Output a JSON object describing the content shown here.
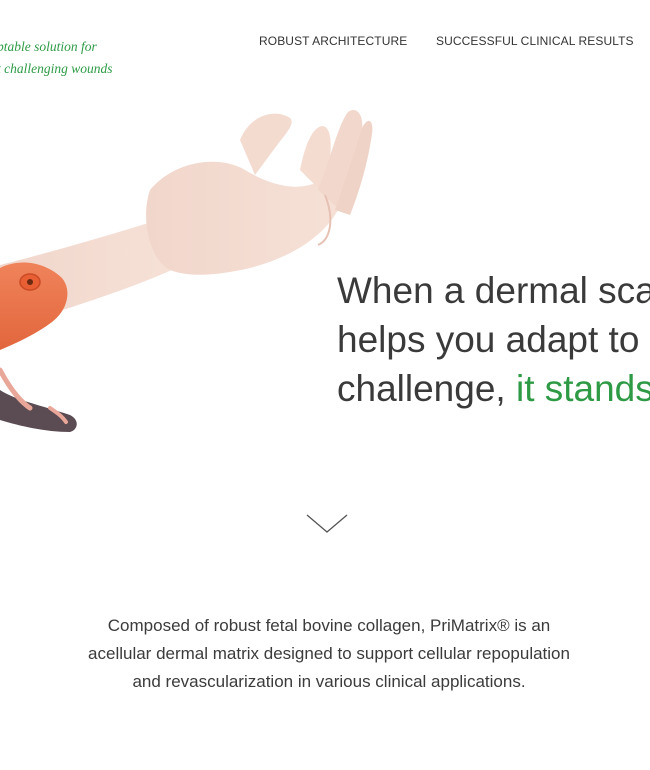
{
  "header": {
    "tagline": [
      "ptable solution for",
      "t challenging wounds"
    ],
    "nav": [
      {
        "label": "ROBUST ARCHITECTURE"
      },
      {
        "label": "SUCCESSFUL CLINICAL RESULTS"
      }
    ]
  },
  "hero": {
    "headline_lines": [
      "When a dermal sca",
      "helps you adapt to",
      "challenge, "
    ],
    "headline_highlight": "it stands",
    "image": "hand-with-chameleon-illustration"
  },
  "scroll": {
    "icon": "chevron-down-icon"
  },
  "intro": {
    "lines": [
      "Composed of robust fetal bovine collagen, PriMatrix® is an",
      "acellular dermal matrix designed to support cellular repopulation",
      "and revascularization in various clinical applications."
    ]
  },
  "colors": {
    "accent": "#2e9a45",
    "text": "#3a3a3a",
    "background": "#ffffff"
  }
}
